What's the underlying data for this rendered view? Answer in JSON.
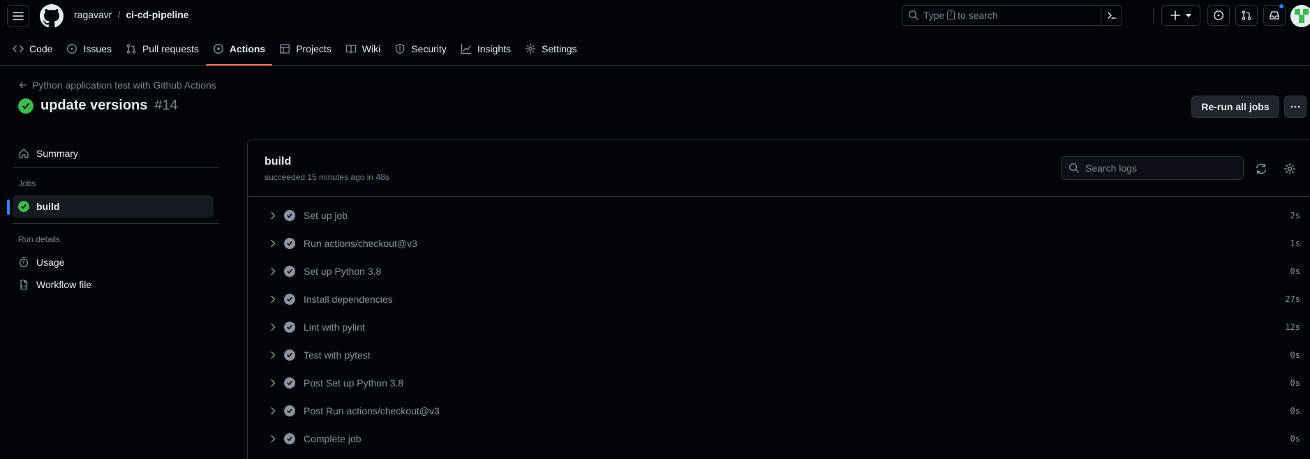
{
  "header": {
    "owner": "ragavavr",
    "separator": "/",
    "repo": "ci-cd-pipeline",
    "search_prefix": "Type",
    "search_key": "/",
    "search_suffix": "to search"
  },
  "tabs": [
    {
      "label": "Code",
      "icon": "code-icon"
    },
    {
      "label": "Issues",
      "icon": "issue-opened-icon"
    },
    {
      "label": "Pull requests",
      "icon": "git-pull-request-icon"
    },
    {
      "label": "Actions",
      "icon": "play-icon",
      "selected": true
    },
    {
      "label": "Projects",
      "icon": "table-icon"
    },
    {
      "label": "Wiki",
      "icon": "book-icon"
    },
    {
      "label": "Security",
      "icon": "shield-icon"
    },
    {
      "label": "Insights",
      "icon": "graph-icon"
    },
    {
      "label": "Settings",
      "icon": "gear-icon"
    }
  ],
  "run": {
    "back_label": "Python application test with Github Actions",
    "title": "update versions",
    "number": "#14",
    "rerun_label": "Re-run all jobs"
  },
  "sidebar": {
    "summary": "Summary",
    "jobs_heading": "Jobs",
    "job": "build",
    "run_details_heading": "Run details",
    "usage": "Usage",
    "workflow_file": "Workflow file"
  },
  "job": {
    "name": "build",
    "meta": "succeeded 15 minutes ago in 48s",
    "search_placeholder": "Search logs",
    "steps": [
      {
        "name": "Set up job",
        "duration": "2s"
      },
      {
        "name": "Run actions/checkout@v3",
        "duration": "1s"
      },
      {
        "name": "Set up Python 3.8",
        "duration": "0s"
      },
      {
        "name": "Install dependencies",
        "duration": "27s"
      },
      {
        "name": "Lint with pylint",
        "duration": "12s"
      },
      {
        "name": "Test with pytest",
        "duration": "0s"
      },
      {
        "name": "Post Set up Python 3.8",
        "duration": "0s"
      },
      {
        "name": "Post Run actions/checkout@v3",
        "duration": "0s"
      },
      {
        "name": "Complete job",
        "duration": "0s"
      }
    ]
  },
  "colors": {
    "success": "#3fb950",
    "accent": "#2f81f7",
    "tab_underline": "#f78166"
  }
}
